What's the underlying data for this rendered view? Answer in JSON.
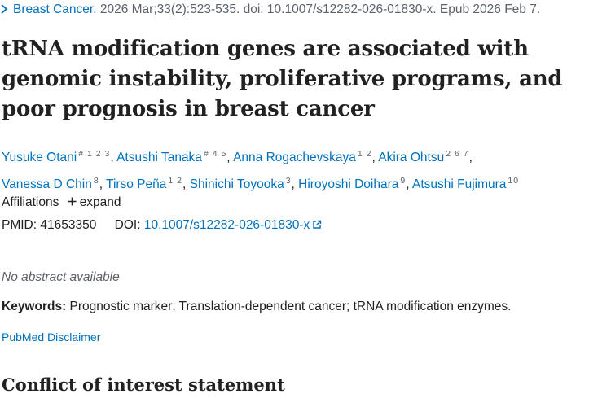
{
  "citation": {
    "journal": "Breast Cancer.",
    "details": " 2026 Mar;33(2):523-535. doi: 10.1007/s12282-026-01830-x. Epub 2026 Feb 7."
  },
  "article": {
    "title": "tRNA modification genes are associated with genomic instability, proliferative programs, and poor prognosis in breast cancer"
  },
  "authors": [
    {
      "name": "Yusuke Otani",
      "sup": "# 1 2 3"
    },
    {
      "name": "Atsushi Tanaka",
      "sup": "# 4 5"
    },
    {
      "name": "Anna Rogachevskaya",
      "sup": "1 2"
    },
    {
      "name": "Akira Ohtsu",
      "sup": "2 6 7"
    },
    {
      "name": "Vanessa D Chin",
      "sup": "8"
    },
    {
      "name": "Tirso Peña",
      "sup": "1 2"
    },
    {
      "name": "Shinichi Toyooka",
      "sup": "3"
    },
    {
      "name": "Hiroyoshi Doihara",
      "sup": "9"
    },
    {
      "name": "Atsushi Fujimura",
      "sup": "10"
    }
  ],
  "affiliations": {
    "label": "Affiliations",
    "expand": "expand"
  },
  "ids": {
    "pmid_label": "PMID:",
    "pmid": "41653350",
    "doi_label": "DOI:",
    "doi": "10.1007/s12282-026-01830-x"
  },
  "abstract": {
    "note": "No abstract available"
  },
  "keywords": {
    "label": "Keywords:",
    "text": " Prognostic marker; Translation-dependent cancer; tRNA modification enzymes."
  },
  "disclaimer": "PubMed Disclaimer",
  "sections": {
    "coi": "Conflict of interest statement"
  },
  "colors": {
    "link": "#0071bc",
    "muted": "#5b616b",
    "text": "#212121"
  },
  "icons": {
    "citation_toggle": "chevron-right-icon",
    "expand": "plus-icon",
    "doi_link": "external-link-icon"
  }
}
